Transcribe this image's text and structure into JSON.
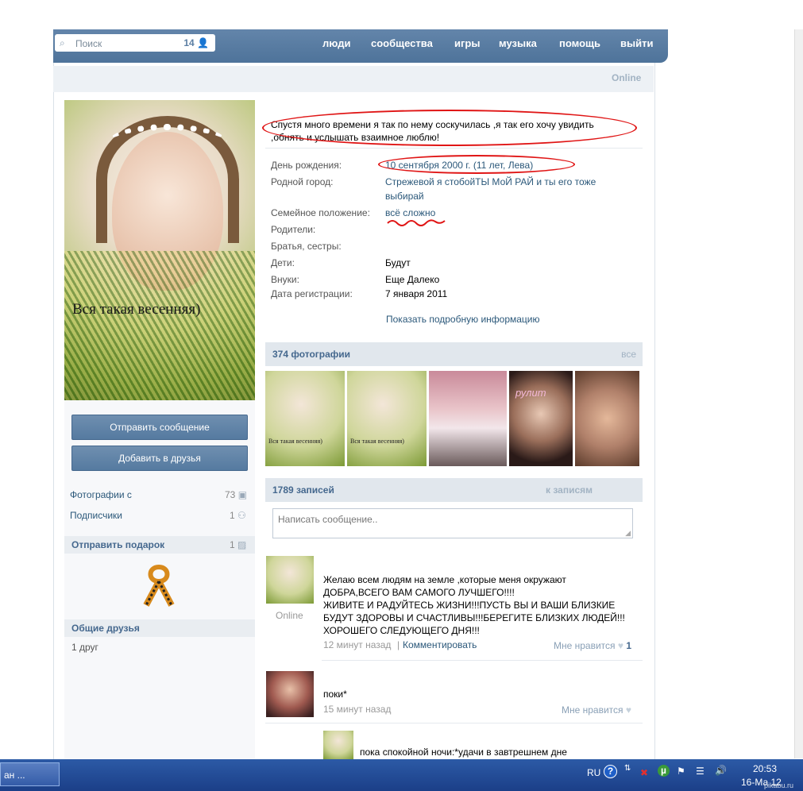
{
  "search": {
    "placeholder": "Поиск",
    "count": "14"
  },
  "nav": [
    "люди",
    "сообщества",
    "игры",
    "музыка",
    "помощь",
    "выйти"
  ],
  "header": {
    "status": "Online"
  },
  "avatar": {
    "caption": "Вся такая весенняя)"
  },
  "left": {
    "send_message": "Отправить сообщение",
    "add_friend": "Добавить в друзья",
    "photos_label": "Фотографии с",
    "photos_count": "73",
    "subscribers_label": "Подписчики",
    "subscribers_count": "1",
    "gift_title": "Отправить подарок",
    "gift_count": "1",
    "common_friends_title": "Общие друзья",
    "common_friends_count": "1 друг"
  },
  "profile": {
    "status_line1": "Спустя много времени я так по нему соскучилась ,я так его хочу увидить",
    "status_line2": ",обнять и услышать взаимное люблю!",
    "fields": [
      {
        "label": "День рождения:",
        "value": "10 сентября 2000 г. (11 лет, Лева)",
        "link": true
      },
      {
        "label": "Родной город:",
        "value": "Стрежевой я стобойТЫ МоЙ РАЙ и ты его тоже",
        "value2": "выбирай",
        "link": true
      },
      {
        "label": "Семейное положение:",
        "value": "всё сложно",
        "link": true
      },
      {
        "label": "Родители:",
        "value": ""
      },
      {
        "label": "Братья, сестры:",
        "value": ""
      },
      {
        "label": "Дети:",
        "value": "Будут"
      },
      {
        "label": "Внуки:",
        "value": "Еще Далеко"
      },
      {
        "label": "Дата регистрации:",
        "value": "7 января 2011"
      }
    ],
    "show_more": "Показать подробную информацию"
  },
  "photos": {
    "title": "374 фотографии",
    "all": "все",
    "thumb_caption": "Вся такая весенняя)",
    "thumb_tag": "рулит"
  },
  "wall": {
    "title": "1789 записей",
    "to_posts": "к записям",
    "input_placeholder": "Написать сообщение..",
    "posts": [
      {
        "author_status": "Online",
        "lines": [
          "Желаю всем людям на земле ,которые меня окружают",
          "ДОБРА,ВСЕГО ВАМ САМОГО ЛУЧШЕГО!!!!",
          "ЖИВИТЕ И РАДУЙТЕСЬ ЖИЗНИ!!!ПУСТЬ ВЫ И ВАШИ БЛИЗКИЕ",
          "БУДУТ ЗДОРОВЫ И СЧАСТЛИВЫ!!!БЕРЕГИТЕ БЛИЗКИХ ЛЮДЕЙ!!!",
          "ХОРОШЕГО СЛЕДУЮЩЕГО ДНЯ!!!"
        ],
        "time": "12 минут назад",
        "comment": "Комментировать",
        "like": "Мне нравится",
        "like_count": "1"
      },
      {
        "lines": [
          "поки*"
        ],
        "time": "15 минут назад",
        "like": "Мне нравится"
      },
      {
        "lines": [
          "пока спокойной ночи:*удачи в завтрешнем дне"
        ]
      }
    ]
  },
  "taskbar": {
    "task": "ан ...",
    "lang": "RU",
    "time": "20:53",
    "date": "16-Ма 12",
    "watermark": "pikabu.ru"
  },
  "colors": {
    "accent": "#5b7ea3",
    "link": "#2b587a",
    "annotation": "#e01515"
  }
}
